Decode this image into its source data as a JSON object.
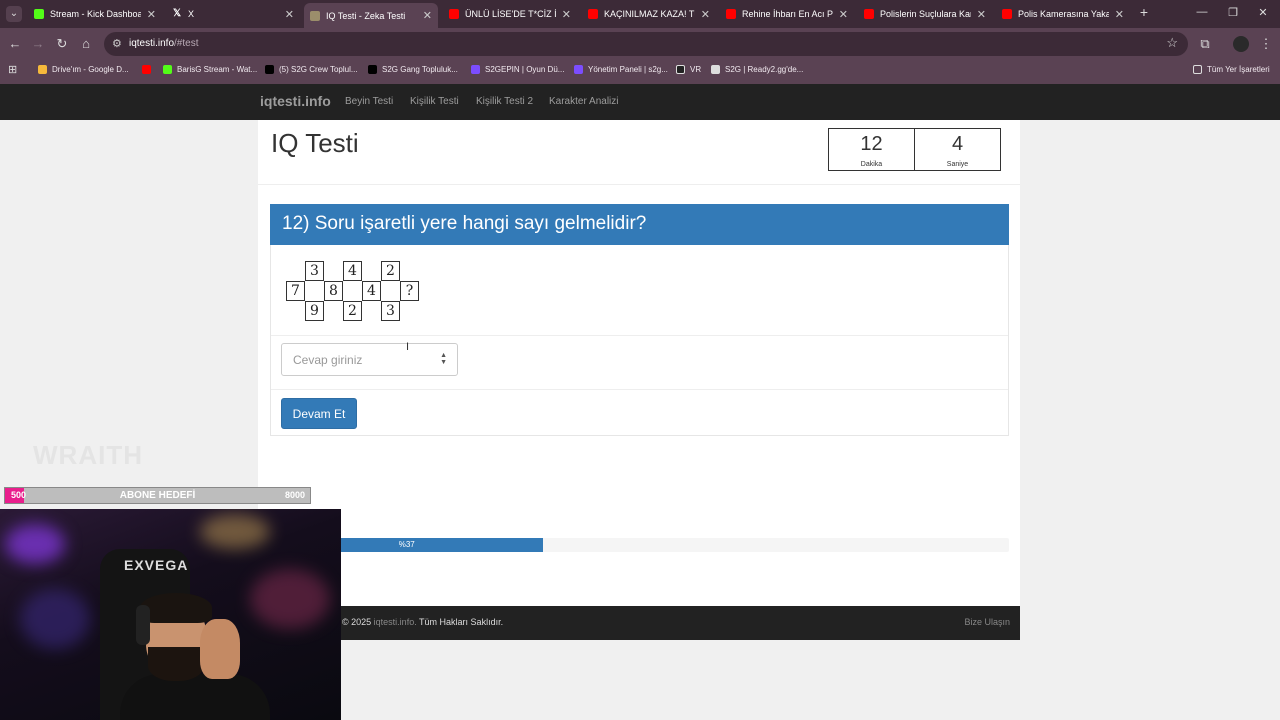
{
  "browser": {
    "tabs": [
      {
        "title": "Stream - Kick Dashboard",
        "icon": "kick-icon",
        "active": false
      },
      {
        "title": "X",
        "icon": "x-icon",
        "active": false
      },
      {
        "title": "IQ Testi - Zeka Testi",
        "icon": "iqtesti-icon",
        "active": true
      },
      {
        "title": "ÜNLÜ LİSE'DE T*CİZ İDDİA",
        "icon": "youtube-icon",
        "active": false
      },
      {
        "title": "KAÇINILMAZ KAZA! Türk",
        "icon": "youtube-icon",
        "active": false
      },
      {
        "title": "Rehine İhbarı En Acı Polis",
        "icon": "youtube-icon",
        "active": false
      },
      {
        "title": "Polislerin Suçlulara Karşı",
        "icon": "youtube-icon",
        "active": false
      },
      {
        "title": "Polis Kamerasına Yakalan",
        "icon": "youtube-icon",
        "active": false
      }
    ],
    "url_host": "iqtesti.info",
    "url_path": "/#test",
    "bookmarks": [
      {
        "label": "Drive'ım - Google D...",
        "icon": "drive-icon"
      },
      {
        "label": "",
        "icon": "youtube-icon"
      },
      {
        "label": "BarisG Stream - Wat...",
        "icon": "kick-icon"
      },
      {
        "label": "(5) S2G Crew Toplul...",
        "icon": "x-icon"
      },
      {
        "label": "S2G Gang Topluluk...",
        "icon": "x-icon"
      },
      {
        "label": "S2GEPIN | Oyun Dü...",
        "icon": "s2g-icon"
      },
      {
        "label": "Yönetim Paneli | s2g...",
        "icon": "s2g-icon"
      },
      {
        "label": "VR",
        "icon": "vr-icon"
      },
      {
        "label": "S2G | Ready2.gg'de...",
        "icon": "web-icon"
      }
    ],
    "all_bookmarks_label": "Tüm Yer İşaretleri"
  },
  "site": {
    "brand": "iqtesti.info",
    "nav": [
      "Beyin Testi",
      "Kişilik Testi",
      "Kişilik Testi 2",
      "Karakter Analizi"
    ],
    "page_title": "IQ Testi",
    "timer": {
      "minutes": "12",
      "minutes_label": "Dakika",
      "seconds": "4",
      "seconds_label": "Saniye"
    },
    "question": "12) Soru işaretli yere hangi sayı gelmelidir?",
    "puzzle": {
      "top": [
        "3",
        "4",
        "2"
      ],
      "middle": [
        "7",
        "8",
        "4",
        "?"
      ],
      "bottom": [
        "9",
        "2",
        "3"
      ]
    },
    "answer_placeholder": "Cevap giriniz",
    "answer_value": "",
    "continue_label": "Devam Et",
    "progress": {
      "percent": 37,
      "label": "%37"
    },
    "footer": {
      "copyright_prefix": "© 2025",
      "copyright_site": "iqtesti.info.",
      "copyright_suffix": "Tüm Hakları Saklıdır.",
      "contact": "Bize Ulaşın"
    }
  },
  "overlay": {
    "watermark": "WRAITH",
    "sub_goal": {
      "current": "500",
      "label": "ABONE HEDEFİ",
      "target": "8000",
      "fraction": 0.0625
    },
    "chair_logo": "EXVEGA"
  },
  "colors": {
    "primary": "#337ab7",
    "navbar": "#222222",
    "goal_fill": "#e91e8c"
  }
}
